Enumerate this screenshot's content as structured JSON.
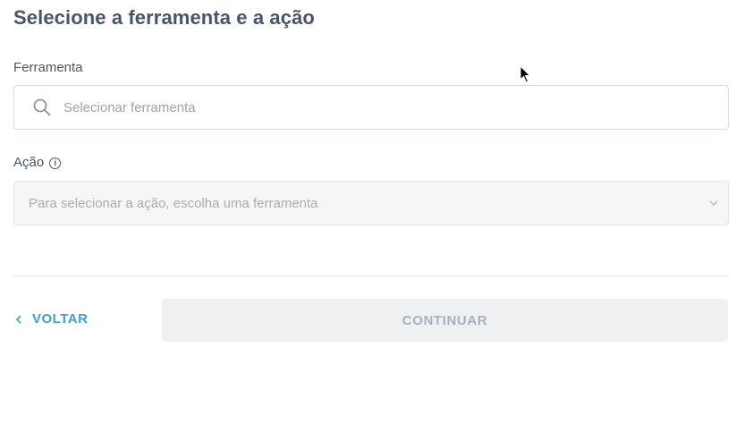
{
  "header": {
    "title": "Selecione a ferramenta e a ação"
  },
  "tool": {
    "label": "Ferramenta",
    "search_placeholder": "Selecionar ferramenta",
    "search_value": ""
  },
  "action": {
    "label": "Ação",
    "info_glyph": "i",
    "select_placeholder": "Para selecionar a ação, escolha uma ferramenta"
  },
  "footer": {
    "back_label": "VOLTAR",
    "continue_label": "CONTINUAR"
  },
  "colors": {
    "accent": "#3aa0dc",
    "title_text": "#4a5568",
    "disabled_bg": "#eef0f2",
    "disabled_text": "#a9b0b8"
  },
  "icons": [
    "search-icon",
    "info-icon",
    "chevron-down-icon",
    "chevron-left-icon",
    "mouse-cursor-icon"
  ]
}
